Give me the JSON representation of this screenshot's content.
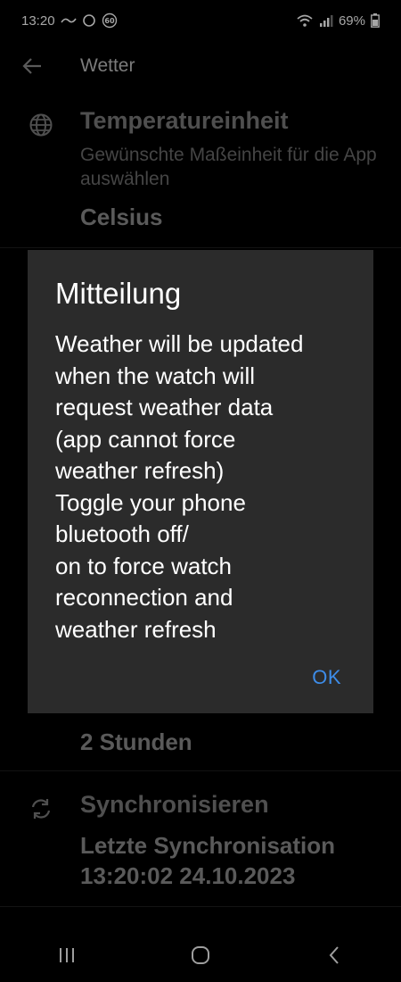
{
  "status_bar": {
    "time": "13:20",
    "battery": "69%",
    "icons": [
      "wave-icon",
      "circle-icon",
      "badge-60-icon",
      "wifi-icon",
      "signal-icon",
      "battery-icon"
    ],
    "badge": "60"
  },
  "app_bar": {
    "title": "Wetter",
    "back_icon": "arrow-back-icon"
  },
  "settings": [
    {
      "icon": "globe-icon",
      "title": "Temperatureinheit",
      "summary": "Gewünschte Maßeinheit für die App auswählen",
      "value": "Celsius"
    },
    {
      "value": "2 Stunden"
    },
    {
      "icon": "sync-icon",
      "title": "Synchronisieren",
      "value_line1": "Letzte Synchronisation",
      "value_line2": "13:20:02 24.10.2023"
    }
  ],
  "dialog": {
    "title": "Mitteilung",
    "message": "Weather will be updated\nwhen the watch will\nrequest weather data\n(app cannot force\nweather refresh)\nToggle your phone\nbluetooth off/\non to force watch\nreconnection and\nweather refresh",
    "ok_label": "OK"
  },
  "nav_bar": {
    "icons": [
      "recents-icon",
      "home-icon",
      "back-icon"
    ]
  },
  "colors": {
    "background": "#000000",
    "dialog_background": "#2b2b2b",
    "accent": "#3d8ce8"
  }
}
